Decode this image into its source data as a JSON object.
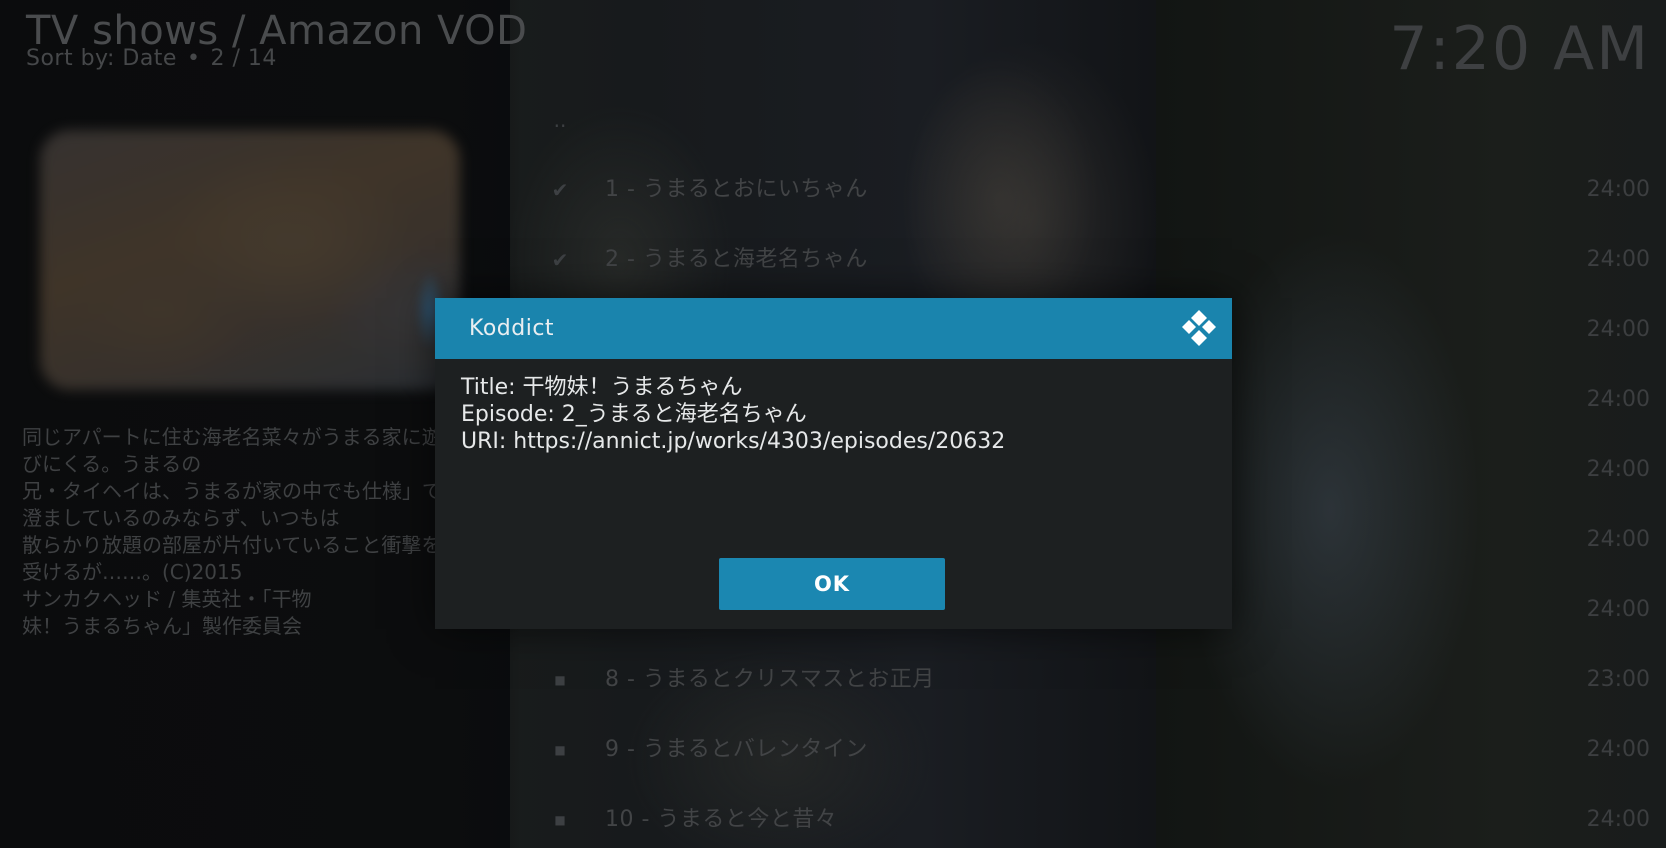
{
  "header": {
    "title": "TV shows / Amazon VOD",
    "sort_label": "Sort by: Date",
    "position": "2 / 14",
    "clock": "7:20 AM"
  },
  "plot": "同じアパートに住む海老名菜々がうまる家に遊びにくる。うまるの\n兄・タイヘイは、うまるが家の中でも仕様」で\n澄ましているのみならず、いつもは\n散らかり放題の部屋が片付いていること衝撃を受けるが……。(C)2015\nサンカクヘッド / 集英社・「干物\n妹！うまるちゃん」製作委員会",
  "episodes": [
    {
      "mark": "..",
      "name": "",
      "duration": ""
    },
    {
      "mark": "✔",
      "name": "1 - うまるとおにいちゃん",
      "duration": "24:00"
    },
    {
      "mark": "✔",
      "name": "2 - うまると海老名ちゃん",
      "duration": "24:00"
    },
    {
      "mark": "",
      "name": "",
      "duration": "24:00"
    },
    {
      "mark": "",
      "name": "",
      "duration": "24:00"
    },
    {
      "mark": "",
      "name": "",
      "duration": "24:00"
    },
    {
      "mark": "",
      "name": "",
      "duration": "24:00"
    },
    {
      "mark": "",
      "name": "",
      "duration": "24:00"
    },
    {
      "mark": "■",
      "name": "8 - うまるとクリスマスとお正月",
      "duration": "23:00"
    },
    {
      "mark": "■",
      "name": "9 - うまるとバレンタイン",
      "duration": "24:00"
    },
    {
      "mark": "■",
      "name": "10 - うまると今と昔々",
      "duration": "24:00"
    }
  ],
  "dialog": {
    "title": "Koddict",
    "line_title": "Title: 干物妹！うまるちゃん",
    "line_episode": "Episode: 2_うまると海老名ちゃん",
    "line_uri": "URI: https://annict.jp/works/4303/episodes/20632",
    "ok_label": "OK"
  },
  "colors": {
    "dialog_header": "#1a84ad",
    "dialog_body": "#1d2021",
    "ok_button": "#1b87b1"
  },
  "icons": {
    "dialog_logo": "kodi-logo-icon",
    "watched": "checkmark-icon",
    "unwatched": "square-icon"
  }
}
